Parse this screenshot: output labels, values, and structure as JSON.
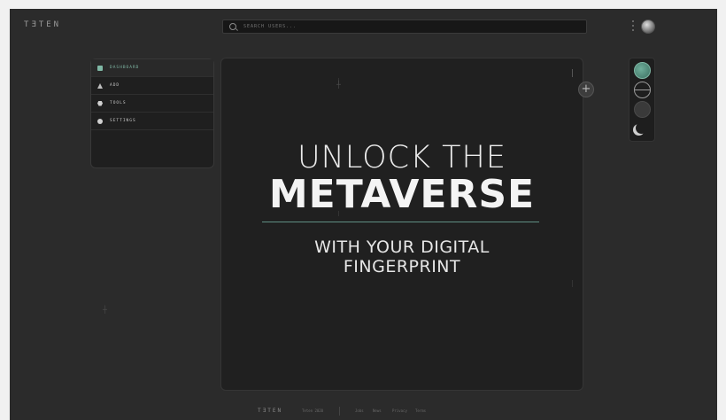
{
  "header": {
    "brand": "TƎTEN",
    "search_placeholder": "SEARCH USERS..."
  },
  "sidebar": {
    "items": [
      {
        "label": "DASHBOARD",
        "icon": "dashboard-icon"
      },
      {
        "label": "ADD",
        "icon": "add-icon"
      },
      {
        "label": "TOOLS",
        "icon": "tools-icon"
      },
      {
        "label": "SETTINGS",
        "icon": "settings-icon"
      }
    ]
  },
  "hero": {
    "line1": "UNLOCK THE",
    "line2": "METAVERSE",
    "line3": "WITH YOUR DIGITAL",
    "line4": "FINGERPRINT"
  },
  "footer": {
    "logo": "TƎTEN",
    "copyright": "Teten 2020",
    "links": [
      "Jobs",
      "News",
      "Privacy",
      "Terms"
    ]
  },
  "colors": {
    "accent": "#7fb8a5",
    "background": "#2b2b2b",
    "panel": "#202020"
  }
}
